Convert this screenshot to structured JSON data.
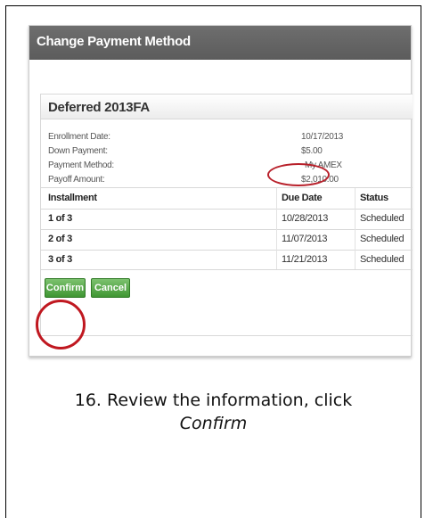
{
  "window": {
    "title": "Change Payment Method"
  },
  "plan": {
    "name": "Deferred 2013FA",
    "fields": [
      {
        "label": "Enrollment Date:",
        "value": "10/17/2013"
      },
      {
        "label": "Down Payment:",
        "value": "$5.00"
      },
      {
        "label": "Payment Method:",
        "value": "My AMEX"
      },
      {
        "label": "Payoff Amount:",
        "value": "$2,010.00"
      }
    ]
  },
  "table": {
    "headers": [
      "Installment",
      "Due Date",
      "Status"
    ],
    "rows": [
      [
        "1 of 3",
        "10/28/2013",
        "Scheduled"
      ],
      [
        "2 of 3",
        "11/07/2013",
        "Scheduled"
      ],
      [
        "3 of 3",
        "11/21/2013",
        "Scheduled"
      ]
    ]
  },
  "actions": {
    "confirm_label": "Confirm",
    "cancel_label": "Cancel"
  },
  "caption": {
    "line1": "16. Review the information, click",
    "line2": "Confirm"
  },
  "colors": {
    "accent_green": "#4aa03c",
    "highlight_red": "#c01820",
    "titlebar": "#666666"
  }
}
